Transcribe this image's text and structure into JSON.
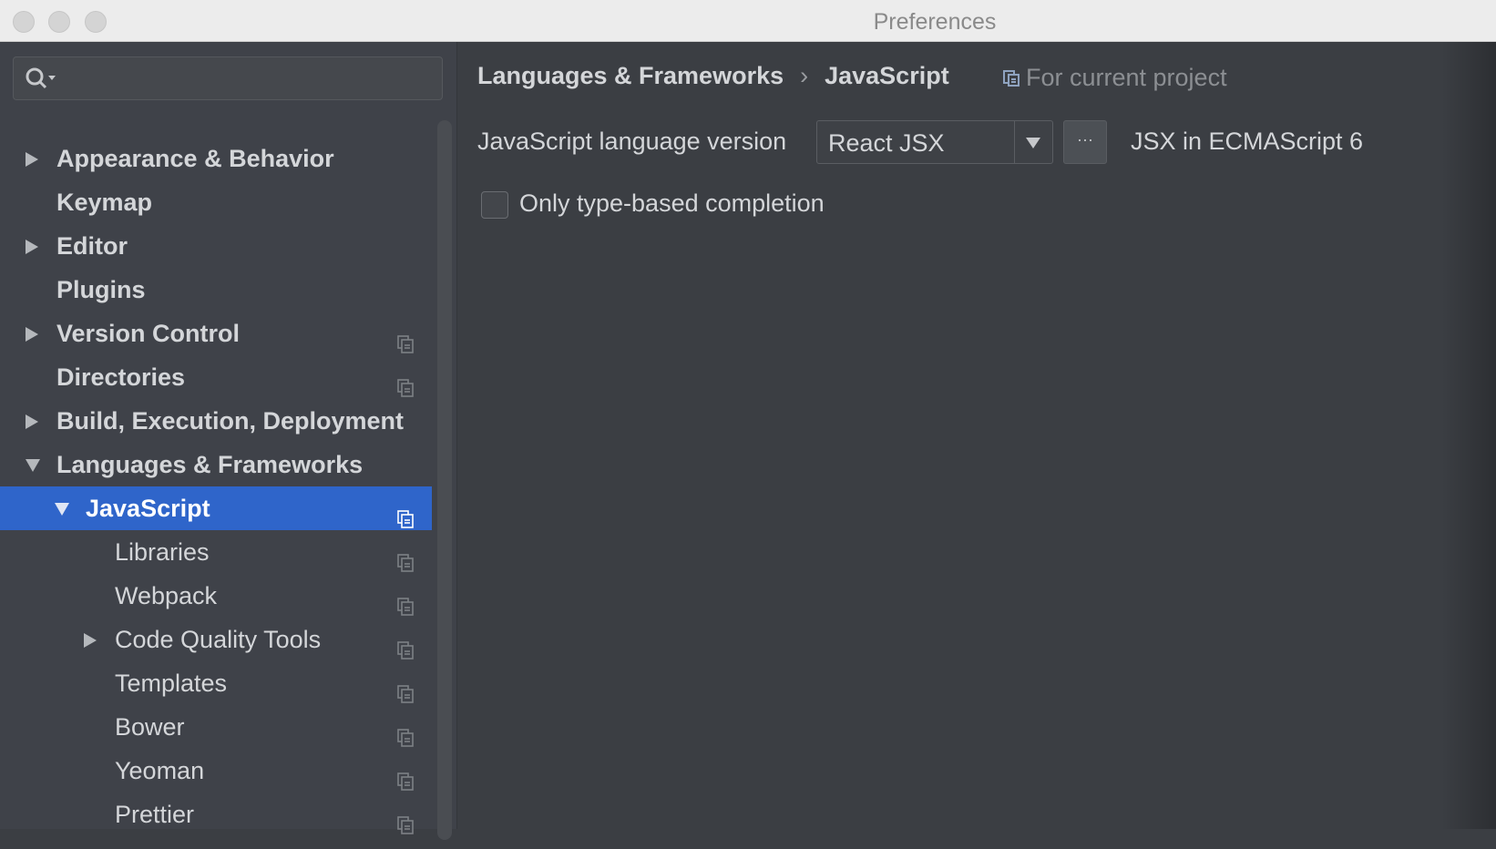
{
  "window": {
    "title": "Preferences"
  },
  "search": {
    "placeholder": ""
  },
  "sidebar": {
    "items": [
      {
        "label": "Appearance & Behavior",
        "expander": "collapsed",
        "project": false
      },
      {
        "label": "Keymap",
        "expander": "none",
        "project": false
      },
      {
        "label": "Editor",
        "expander": "collapsed",
        "project": false
      },
      {
        "label": "Plugins",
        "expander": "none",
        "project": false
      },
      {
        "label": "Version Control",
        "expander": "collapsed",
        "project": true
      },
      {
        "label": "Directories",
        "expander": "none",
        "project": true
      },
      {
        "label": "Build, Execution, Deployment",
        "expander": "collapsed",
        "project": false
      },
      {
        "label": "Languages & Frameworks",
        "expander": "expanded",
        "project": false
      },
      {
        "label": "JavaScript",
        "expander": "expanded",
        "project": true,
        "selected": true
      },
      {
        "label": "Libraries",
        "expander": "none",
        "project": true
      },
      {
        "label": "Webpack",
        "expander": "none",
        "project": true
      },
      {
        "label": "Code Quality Tools",
        "expander": "collapsed",
        "project": true
      },
      {
        "label": "Templates",
        "expander": "none",
        "project": true
      },
      {
        "label": "Bower",
        "expander": "none",
        "project": true
      },
      {
        "label": "Yeoman",
        "expander": "none",
        "project": true
      },
      {
        "label": "Prettier",
        "expander": "none",
        "project": true
      }
    ]
  },
  "main": {
    "breadcrumb": [
      "Languages & Frameworks",
      "JavaScript"
    ],
    "breadcrumb_sep": "›",
    "scope": "For current project",
    "version_label": "JavaScript language version",
    "version_value": "React JSX",
    "more_label": "···",
    "version_desc": "JSX in ECMAScript 6",
    "checkbox_label": "Only type-based completion",
    "checkbox_checked": false
  },
  "colors": {
    "selection": "#2f65ca",
    "sidebar": "#3f4249",
    "panel": "#3b3e43"
  }
}
